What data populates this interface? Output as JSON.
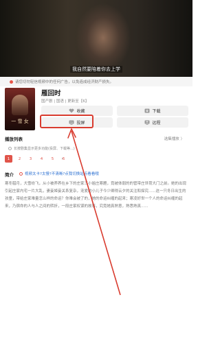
{
  "video": {
    "subtitle": "我自然要陪着你去上学"
  },
  "notice": {
    "text": "请您切勿轻信视频中的任何广告，以免造成经济财产损失。"
  },
  "poster": {
    "title": "一 雪 女"
  },
  "show": {
    "title": "雁回时",
    "meta": "国产剧 | 国语 | 更新至【6】"
  },
  "actions": {
    "favorite": "收藏",
    "download": "下载",
    "cast": "投屏",
    "remote": "远程"
  },
  "playlist": {
    "heading": "播放列表",
    "right_label": "选集播放 〉",
    "tip": "长按剧集显示更多功能(投屏、下载等...)",
    "episodes": [
      "1",
      "2",
      "3",
      "4",
      "5",
      "6"
    ],
    "active_index": 0
  },
  "intro": {
    "label": "简介",
    "link": "视频太卡?太慢?不清晰?点我切换站点看看哦",
    "description": "寒冬腊月，大雪纷飞，从小被养养在乡下的庄家三小姐庄寒雁，竟被体弱的的管带庄世荷大门之前。她的出现引起庄家内宅一片大乱，妻妾姬妾关系复杂，宠爱的小儿子今少卿得云夕的关注和探究......这一只冬日出生的孩童，带给庄家难量怎么样的命运？你难会被了的，她的命运纠缠的起来；寒凌好世一个人的命运纠缠的起来，乃宿命的人与人之间的转折，一段庄家权谋的故事，究竟她真熟意，熟悉熟真......"
  },
  "colors": {
    "accent": "#e0544a",
    "highlight": "#d93b2e",
    "link": "#2e72d2"
  }
}
